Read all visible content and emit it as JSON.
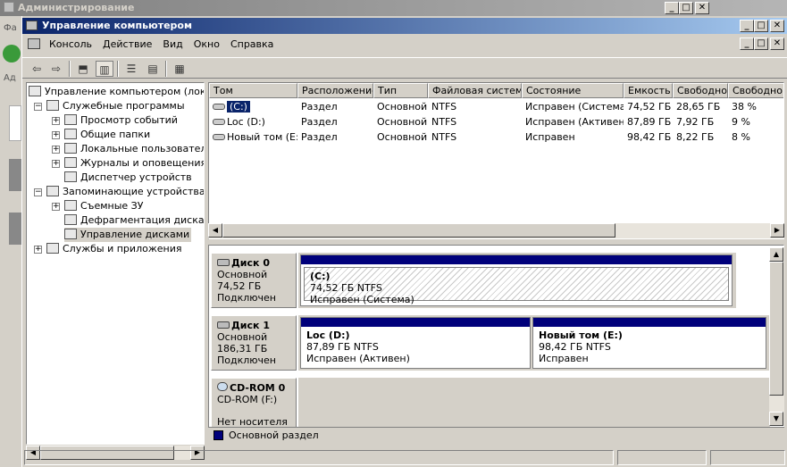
{
  "bg_window": {
    "title": "Администрирование",
    "side_labels": [
      "Фа",
      "Ад"
    ]
  },
  "window": {
    "title": "Управление компьютером"
  },
  "caption_buttons": {
    "min": "_",
    "max": "□",
    "close": "✕"
  },
  "menu": [
    "Консоль",
    "Действие",
    "Вид",
    "Окно",
    "Справка"
  ],
  "toolbar": [
    "back-icon",
    "forward-icon",
    "up-folder-icon",
    "show-hide-tree-icon",
    "properties-icon",
    "help-icon",
    "export-icon"
  ],
  "tree": {
    "items": [
      {
        "label": "Управление компьютером (локальн",
        "icon": "computer-icon"
      },
      {
        "label": "Служебные программы",
        "icon": "tools-icon"
      },
      {
        "label": "Просмотр событий",
        "icon": "event-viewer-icon"
      },
      {
        "label": "Общие папки",
        "icon": "shared-folder-icon"
      },
      {
        "label": "Локальные пользователи",
        "icon": "users-icon"
      },
      {
        "label": "Журналы и оповещения пр",
        "icon": "logs-icon"
      },
      {
        "label": "Диспетчер устройств",
        "icon": "device-manager-icon"
      },
      {
        "label": "Запоминающие устройства",
        "icon": "storage-icon"
      },
      {
        "label": "Съемные ЗУ",
        "icon": "removable-storage-icon"
      },
      {
        "label": "Дефрагментация диска",
        "icon": "defrag-icon"
      },
      {
        "label": "Управление дисками",
        "icon": "disk-management-icon"
      },
      {
        "label": "Службы и приложения",
        "icon": "services-icon"
      }
    ]
  },
  "volumes": {
    "columns": [
      "Том",
      "Расположение",
      "Тип",
      "Файловая система",
      "Состояние",
      "Емкость",
      "Свободно",
      "Свободно %"
    ],
    "rows": [
      [
        "(C:)",
        "Раздел",
        "Основной",
        "NTFS",
        "Исправен (Система)",
        "74,52 ГБ",
        "28,65 ГБ",
        "38 %"
      ],
      [
        "Loc (D:)",
        "Раздел",
        "Основной",
        "NTFS",
        "Исправен (Активен)",
        "87,89 ГБ",
        "7,92 ГБ",
        "9 %"
      ],
      [
        "Новый том (E:)",
        "Раздел",
        "Основной",
        "NTFS",
        "Исправен",
        "98,42 ГБ",
        "8,22 ГБ",
        "8 %"
      ]
    ]
  },
  "disks": [
    {
      "name": "Диск 0",
      "type": "Основной",
      "size": "74,52 ГБ",
      "status": "Подключен",
      "partitions": [
        {
          "name": "(C:)",
          "size": "74,52 ГБ NTFS",
          "state": "Исправен (Система)"
        }
      ]
    },
    {
      "name": "Диск 1",
      "type": "Основной",
      "size": "186,31 ГБ",
      "status": "Подключен",
      "partitions": [
        {
          "name": "Loc  (D:)",
          "size": "87,89 ГБ NTFS",
          "state": "Исправен (Активен)"
        },
        {
          "name": "Новый том  (E:)",
          "size": "98,42 ГБ NTFS",
          "state": "Исправен"
        }
      ]
    },
    {
      "name": "CD-ROM 0",
      "type": "CD-ROM (F:)",
      "size": "",
      "status": "Нет носителя",
      "partitions": []
    }
  ],
  "legend": {
    "label": "Основной раздел",
    "color": "#00007b"
  }
}
